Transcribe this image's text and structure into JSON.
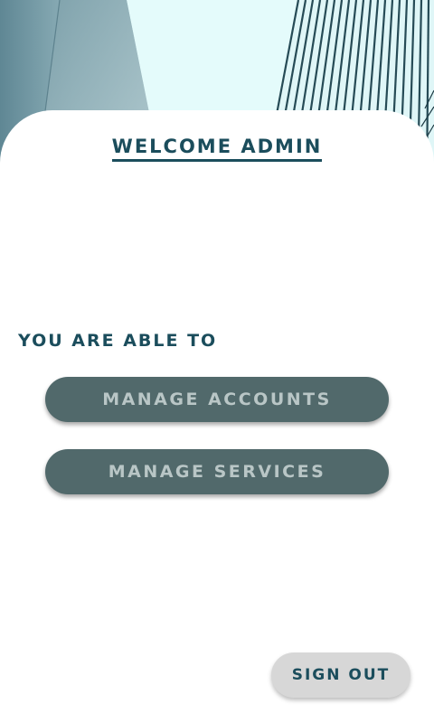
{
  "header": {
    "title": "WELCOME ADMIN"
  },
  "main": {
    "section_label": "YOU ARE ABLE TO",
    "actions": [
      {
        "label": "MANAGE ACCOUNTS"
      },
      {
        "label": "MANAGE SERVICES"
      }
    ]
  },
  "footer": {
    "sign_out_label": "SIGN OUT"
  },
  "colors": {
    "primary_text": "#1b4d5c",
    "action_button_bg": "#51696b",
    "action_button_text": "#b9c6c6",
    "secondary_button_bg": "#d7d7d7",
    "background": "#ffffff"
  }
}
